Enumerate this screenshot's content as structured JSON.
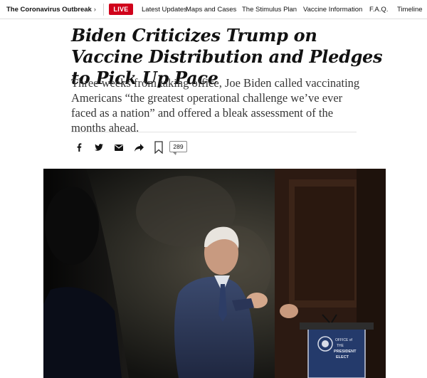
{
  "nav": {
    "section": "The Coronavirus Outbreak",
    "section_chevron": "›",
    "live": "LIVE",
    "items": [
      {
        "label": "Latest Updates"
      },
      {
        "label": "Maps and Cases"
      },
      {
        "label": "The Stimulus Plan"
      },
      {
        "label": "Vaccine Information"
      },
      {
        "label": "F.A.Q."
      },
      {
        "label": "Timeline"
      }
    ]
  },
  "article": {
    "headline": "Biden Criticizes Trump on Vaccine Distribution and Pledges to Pick Up Pace",
    "summary": "Three weeks from taking office, Joe Biden called vaccinating Americans “the greatest operational challenge we’ve ever faced as a nation” and offered a bleak assessment of the months ahead."
  },
  "share": {
    "icons": [
      "facebook-icon",
      "twitter-icon",
      "email-icon",
      "share-icon",
      "bookmark-icon"
    ],
    "comment_count": "289"
  },
  "photo": {
    "podium_text": [
      "OFFICE of",
      "THE",
      "PRESIDENT",
      "ELECT"
    ]
  },
  "colors": {
    "live_red": "#d0021b",
    "text": "#121212",
    "summary_text": "#363636"
  }
}
